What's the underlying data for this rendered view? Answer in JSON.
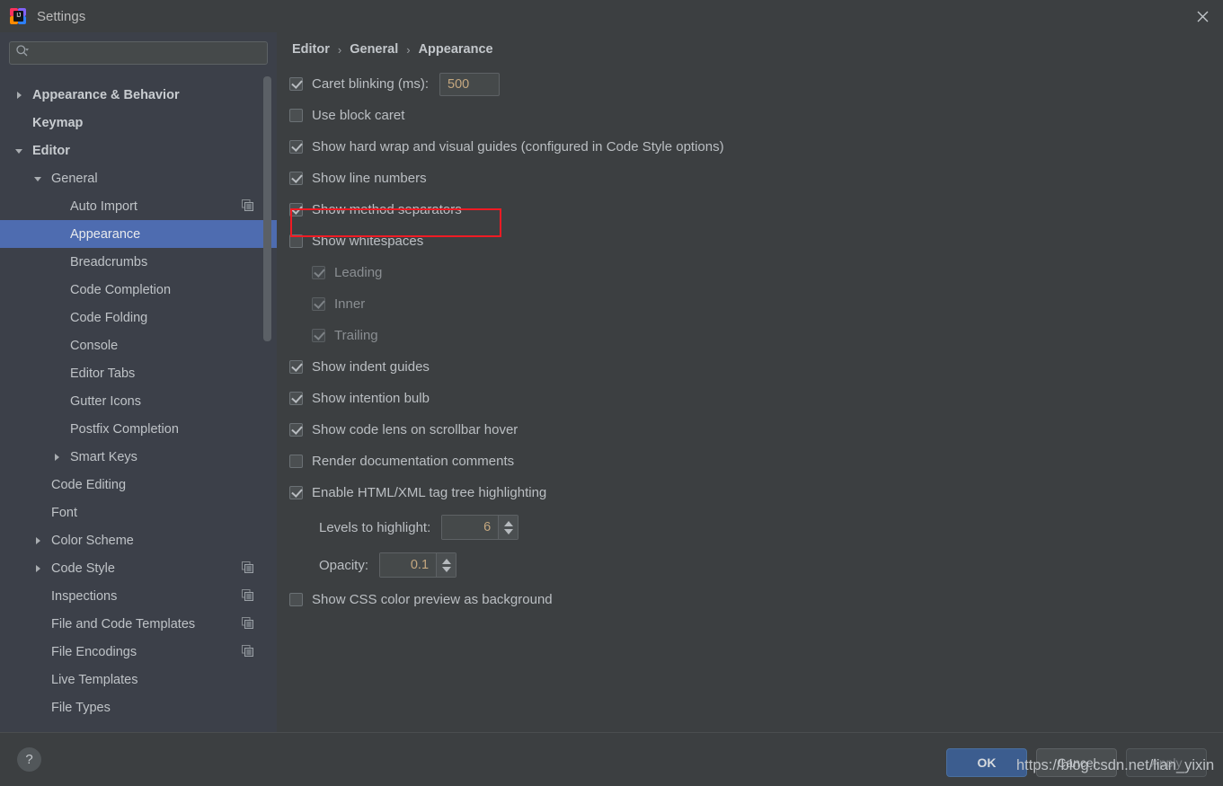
{
  "window": {
    "title": "Settings",
    "logo_icon": "intellij-idea-logo",
    "logo_badge": "IJ",
    "close_icon": "close-icon"
  },
  "search": {
    "value": "",
    "placeholder": "",
    "icon": "search-icon"
  },
  "sidebar": {
    "scrollbar": "vertical-scrollbar",
    "items": [
      {
        "label": "Appearance & Behavior",
        "indent": 0,
        "twisty": "collapsed",
        "bold": true,
        "selected": false,
        "copy_icon": false
      },
      {
        "label": "Keymap",
        "indent": 0,
        "twisty": "none",
        "bold": true,
        "selected": false,
        "copy_icon": false
      },
      {
        "label": "Editor",
        "indent": 0,
        "twisty": "expanded",
        "bold": true,
        "selected": false,
        "copy_icon": false
      },
      {
        "label": "General",
        "indent": 1,
        "twisty": "expanded",
        "bold": false,
        "selected": false,
        "copy_icon": false
      },
      {
        "label": "Auto Import",
        "indent": 2,
        "twisty": "none",
        "bold": false,
        "selected": false,
        "copy_icon": true
      },
      {
        "label": "Appearance",
        "indent": 2,
        "twisty": "none",
        "bold": false,
        "selected": true,
        "copy_icon": false
      },
      {
        "label": "Breadcrumbs",
        "indent": 2,
        "twisty": "none",
        "bold": false,
        "selected": false,
        "copy_icon": false
      },
      {
        "label": "Code Completion",
        "indent": 2,
        "twisty": "none",
        "bold": false,
        "selected": false,
        "copy_icon": false
      },
      {
        "label": "Code Folding",
        "indent": 2,
        "twisty": "none",
        "bold": false,
        "selected": false,
        "copy_icon": false
      },
      {
        "label": "Console",
        "indent": 2,
        "twisty": "none",
        "bold": false,
        "selected": false,
        "copy_icon": false
      },
      {
        "label": "Editor Tabs",
        "indent": 2,
        "twisty": "none",
        "bold": false,
        "selected": false,
        "copy_icon": false
      },
      {
        "label": "Gutter Icons",
        "indent": 2,
        "twisty": "none",
        "bold": false,
        "selected": false,
        "copy_icon": false
      },
      {
        "label": "Postfix Completion",
        "indent": 2,
        "twisty": "none",
        "bold": false,
        "selected": false,
        "copy_icon": false
      },
      {
        "label": "Smart Keys",
        "indent": 2,
        "twisty": "collapsed",
        "bold": false,
        "selected": false,
        "copy_icon": false
      },
      {
        "label": "Code Editing",
        "indent": 1,
        "twisty": "none",
        "bold": false,
        "selected": false,
        "copy_icon": false
      },
      {
        "label": "Font",
        "indent": 1,
        "twisty": "none",
        "bold": false,
        "selected": false,
        "copy_icon": false
      },
      {
        "label": "Color Scheme",
        "indent": 1,
        "twisty": "collapsed",
        "bold": false,
        "selected": false,
        "copy_icon": false
      },
      {
        "label": "Code Style",
        "indent": 1,
        "twisty": "collapsed",
        "bold": false,
        "selected": false,
        "copy_icon": true
      },
      {
        "label": "Inspections",
        "indent": 1,
        "twisty": "none",
        "bold": false,
        "selected": false,
        "copy_icon": true
      },
      {
        "label": "File and Code Templates",
        "indent": 1,
        "twisty": "none",
        "bold": false,
        "selected": false,
        "copy_icon": true
      },
      {
        "label": "File Encodings",
        "indent": 1,
        "twisty": "none",
        "bold": false,
        "selected": false,
        "copy_icon": true
      },
      {
        "label": "Live Templates",
        "indent": 1,
        "twisty": "none",
        "bold": false,
        "selected": false,
        "copy_icon": false
      },
      {
        "label": "File Types",
        "indent": 1,
        "twisty": "none",
        "bold": false,
        "selected": false,
        "copy_icon": false
      }
    ]
  },
  "main": {
    "breadcrumb": [
      "Editor",
      "General",
      "Appearance"
    ],
    "breadcrumb_separator": "›",
    "options": [
      {
        "kind": "checkbox-input",
        "label": "Caret blinking (ms):",
        "checked": true,
        "dim": false,
        "indent": 0,
        "value": "500"
      },
      {
        "kind": "checkbox",
        "label": "Use block caret",
        "checked": false,
        "dim": false,
        "indent": 0
      },
      {
        "kind": "checkbox",
        "label": "Show hard wrap and visual guides (configured in Code Style options)",
        "checked": true,
        "dim": false,
        "indent": 0
      },
      {
        "kind": "checkbox",
        "label": "Show line numbers",
        "checked": true,
        "dim": false,
        "indent": 0
      },
      {
        "kind": "checkbox",
        "label": "Show method separators",
        "checked": true,
        "dim": false,
        "indent": 0,
        "highlighted": true
      },
      {
        "kind": "checkbox",
        "label": "Show whitespaces",
        "checked": false,
        "dim": false,
        "indent": 0
      },
      {
        "kind": "checkbox",
        "label": "Leading",
        "checked": true,
        "dim": true,
        "indent": 1
      },
      {
        "kind": "checkbox",
        "label": "Inner",
        "checked": true,
        "dim": true,
        "indent": 1
      },
      {
        "kind": "checkbox",
        "label": "Trailing",
        "checked": true,
        "dim": true,
        "indent": 1
      },
      {
        "kind": "checkbox",
        "label": "Show indent guides",
        "checked": true,
        "dim": false,
        "indent": 0
      },
      {
        "kind": "checkbox",
        "label": "Show intention bulb",
        "checked": true,
        "dim": false,
        "indent": 0
      },
      {
        "kind": "checkbox",
        "label": "Show code lens on scrollbar hover",
        "checked": true,
        "dim": false,
        "indent": 0
      },
      {
        "kind": "checkbox",
        "label": "Render documentation comments",
        "checked": false,
        "dim": false,
        "indent": 0
      },
      {
        "kind": "checkbox",
        "label": "Enable HTML/XML tag tree highlighting",
        "checked": true,
        "dim": false,
        "indent": 0
      },
      {
        "kind": "spinner",
        "label": "Levels to highlight:",
        "value": "6"
      },
      {
        "kind": "spinner",
        "label": "Opacity:",
        "value": "0.1"
      },
      {
        "kind": "checkbox",
        "label": "Show CSS color preview as background",
        "checked": false,
        "dim": false,
        "indent": 0
      }
    ]
  },
  "footer": {
    "help_label": "?",
    "ok_label": "OK",
    "cancel_label": "Cancel",
    "apply_label": "Apply"
  },
  "watermark": {
    "text": "https://blog.csdn.net/lian_yixin"
  },
  "colors": {
    "window_bg": "#3c3f41",
    "sidebar_bg": "#3c4049",
    "selection": "#4e6cb0",
    "highlight_rect": "#f01b24",
    "primary_button": "#3c5d8f",
    "value_text": "#c4a77f"
  }
}
